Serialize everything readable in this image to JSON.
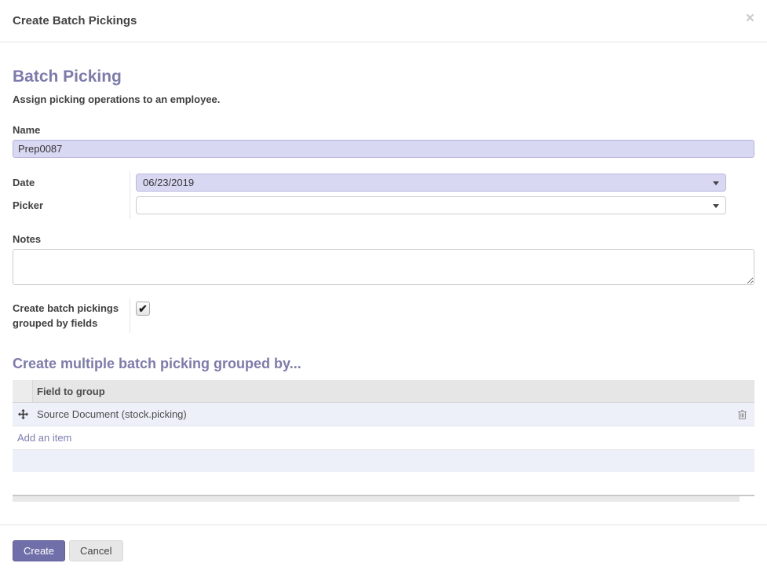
{
  "dialog": {
    "title": "Create Batch Pickings",
    "icons": {
      "close": "×",
      "check": "✔"
    }
  },
  "form": {
    "heading": "Batch Picking",
    "subtitle": "Assign picking operations to an employee.",
    "fields": {
      "name": {
        "label": "Name",
        "value": "Prep0087"
      },
      "date": {
        "label": "Date",
        "value": "06/23/2019"
      },
      "picker": {
        "label": "Picker",
        "value": ""
      },
      "notes": {
        "label": "Notes",
        "value": ""
      },
      "grouped": {
        "label": "Create batch pickings grouped by fields",
        "checked": true
      }
    }
  },
  "group_by": {
    "heading": "Create multiple batch picking grouped by...",
    "table": {
      "header": "Field to group",
      "rows": [
        {
          "field": "Source Document (stock.picking)"
        }
      ],
      "add_item": "Add an item"
    }
  },
  "footer": {
    "create": "Create",
    "cancel": "Cancel"
  },
  "colors": {
    "accent": "#7c7bad",
    "field_highlight": "#d8d8f3",
    "row_highlight": "#eef0f9",
    "table_header_gray": "#e6e6e6",
    "create_button": "#716fa9"
  }
}
